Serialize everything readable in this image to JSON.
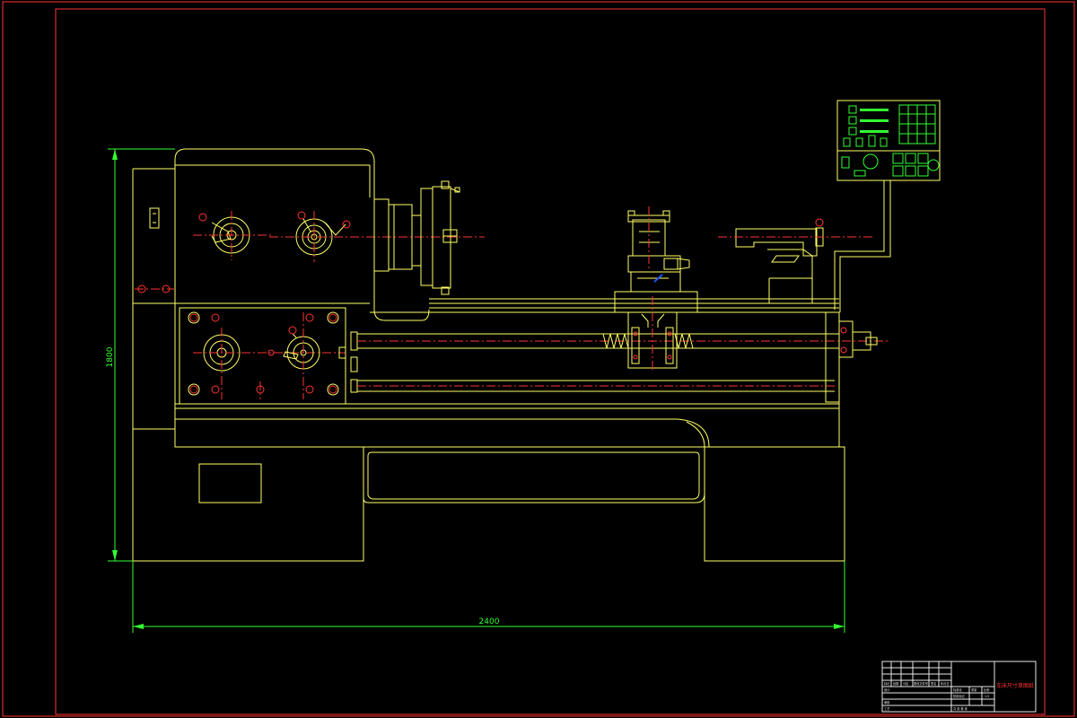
{
  "drawing": {
    "dimensions": {
      "height_label": "1800",
      "width_label": "2400"
    },
    "title_block": {
      "title": "车床尺寸草图纸",
      "row_labels": [
        "标记",
        "处数",
        "分区",
        "更改文件号",
        "签名",
        "年月日"
      ],
      "left_labels": [
        "设计",
        "审核",
        "工艺"
      ],
      "right_labels": [
        "阶段标记",
        "重量",
        "比例"
      ],
      "ratio": "1:5",
      "standard": "标准化",
      "sheet": "共 张 第 张"
    },
    "colors": {
      "outline": "#ffff66",
      "center": "#ff3333",
      "dimension": "#33ff33",
      "border": "#ff3333"
    }
  }
}
